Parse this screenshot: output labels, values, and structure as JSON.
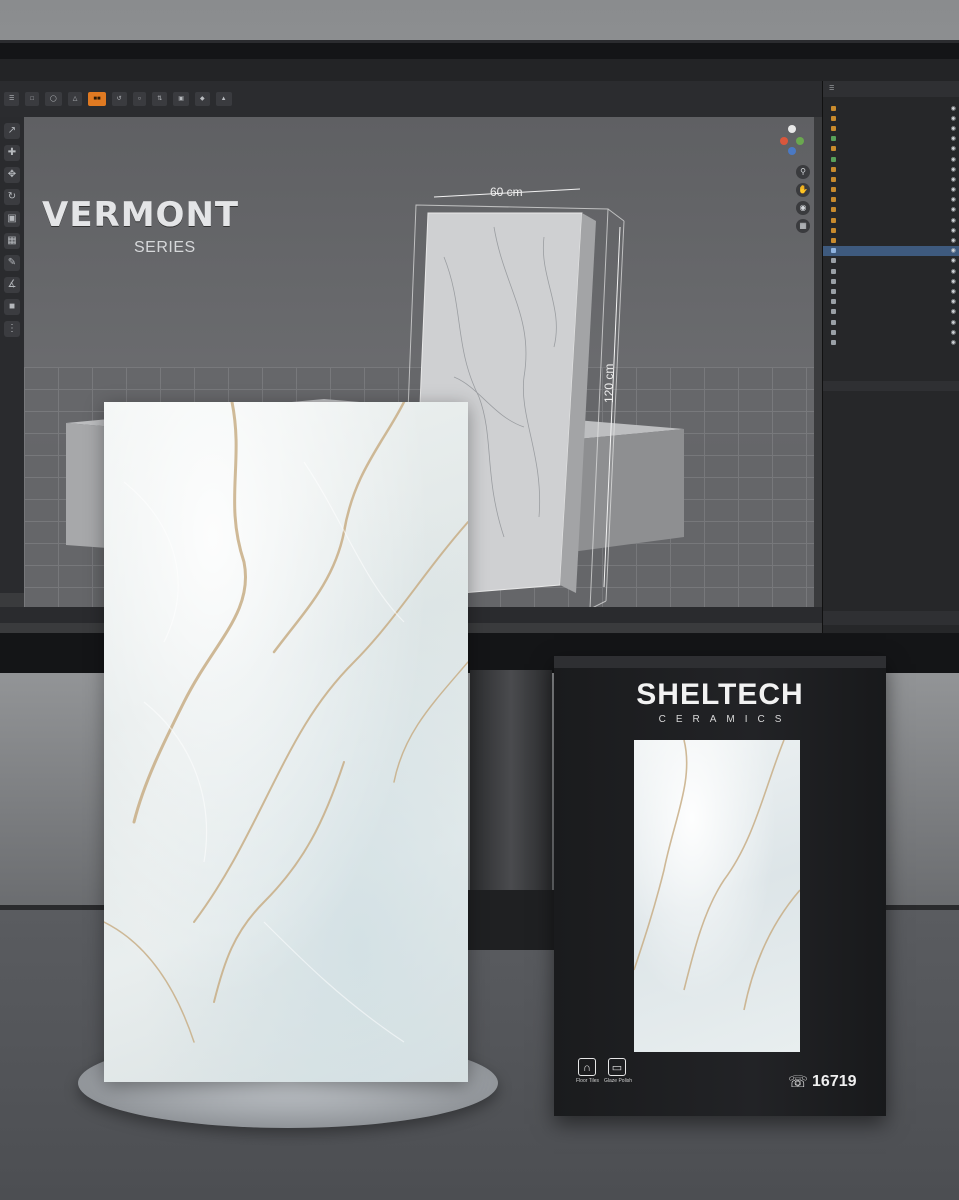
{
  "screen": {
    "menubar_text": [],
    "toolbar_buttons": [],
    "outliner_rows": [],
    "series_logo": {
      "title": "VERMONT",
      "subtitle": "SERIES"
    },
    "dimensions": {
      "width": "60 cm",
      "height": "120 cm"
    }
  },
  "box": {
    "brand": "SHELTECH",
    "subbrand": "CERAMICS",
    "icons": [
      {
        "icon": "tile-floor-icon",
        "caption": "Floor Tiles"
      },
      {
        "icon": "glaze-polish-icon",
        "caption": "Glaze Polish"
      }
    ],
    "hotline_icon": "headset-icon",
    "hotline": "16719"
  },
  "colors": {
    "accent_toolbar": "#e07a22",
    "selection": "#3e5a7e",
    "marble_vein": "#c8ae86",
    "box": "#1d1e20"
  }
}
